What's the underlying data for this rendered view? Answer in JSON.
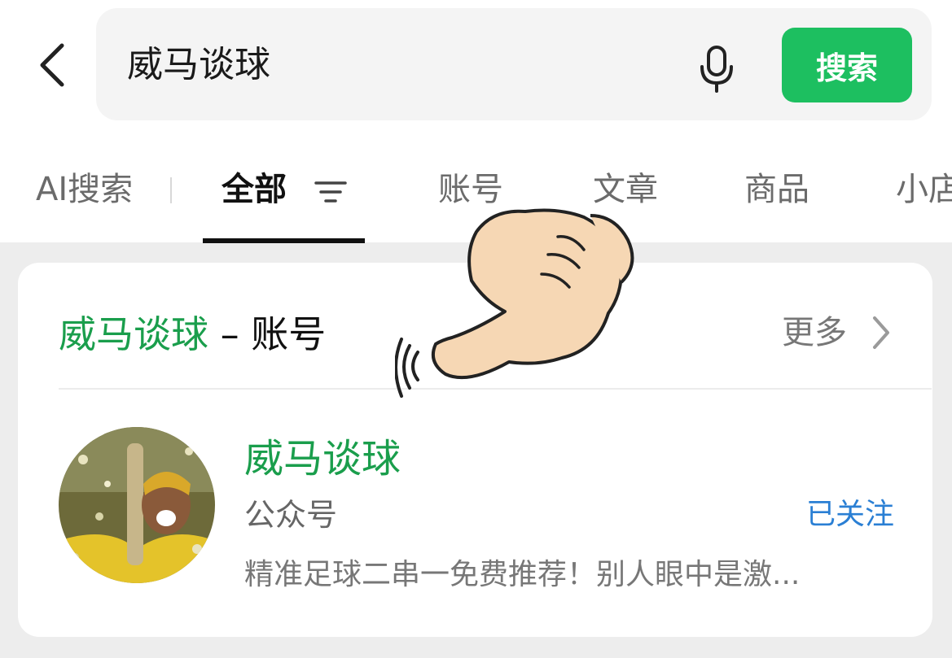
{
  "search": {
    "query": "威马谈球",
    "button_label": "搜索"
  },
  "tabs": [
    {
      "label": "AI搜索"
    },
    {
      "label": "全部",
      "active": true
    },
    {
      "label": "账号"
    },
    {
      "label": "文章"
    },
    {
      "label": "商品"
    },
    {
      "label": "小店"
    }
  ],
  "section": {
    "title_keyword": "威马谈球",
    "title_separator": "–",
    "title_suffix": "账号",
    "more_label": "更多"
  },
  "account": {
    "name": "威马谈球",
    "type": "公众号",
    "follow_status": "已关注",
    "description": "精准足球二串一免费推荐！别人眼中是激..."
  },
  "colors": {
    "brand_green": "#1dbf60",
    "keyword_green": "#1a9e4c",
    "link_blue": "#2a7fd4"
  },
  "icons": [
    "back-arrow-icon",
    "microphone-icon",
    "filter-icon",
    "chevron-right-icon",
    "pointing-hand-icon"
  ]
}
